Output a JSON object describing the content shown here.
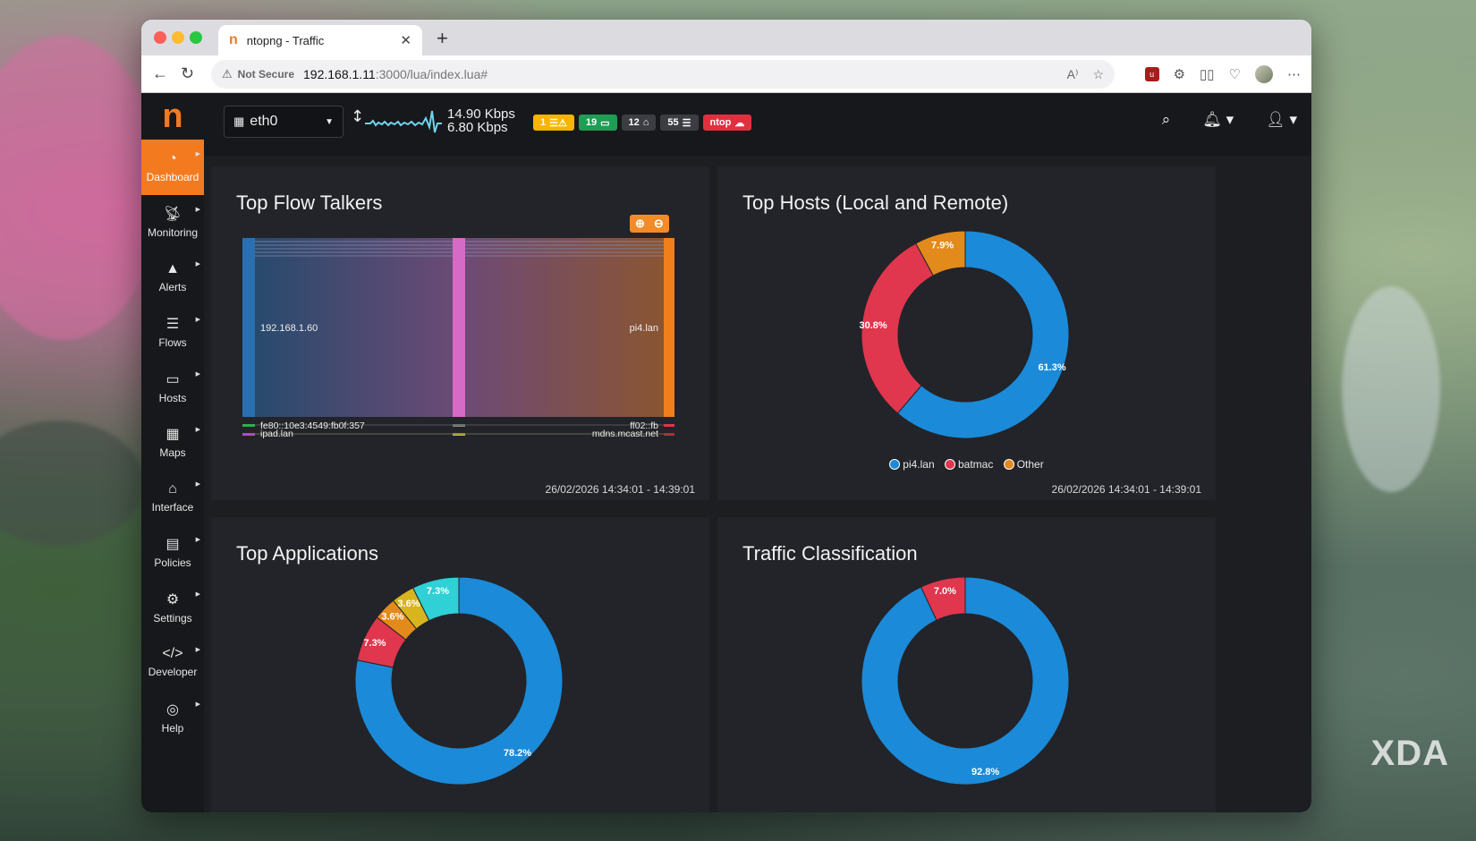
{
  "browser": {
    "tab_title": "ntopng - Traffic",
    "tab_logo": "n",
    "not_secure_label": "Not Secure",
    "url_host": "192.168.1.11",
    "url_path": ":3000/lua/index.lua#"
  },
  "app": {
    "brand": "n",
    "sidebar": [
      {
        "label": "Dashboard",
        "icon": "gauge-icon",
        "active": true
      },
      {
        "label": "Monitoring",
        "icon": "satellite-dish-icon",
        "active": false
      },
      {
        "label": "Alerts",
        "icon": "warning-icon",
        "active": false
      },
      {
        "label": "Flows",
        "icon": "list-icon",
        "active": false
      },
      {
        "label": "Hosts",
        "icon": "laptop-icon",
        "active": false
      },
      {
        "label": "Maps",
        "icon": "map-icon",
        "active": false
      },
      {
        "label": "Interface",
        "icon": "ethernet-icon",
        "active": false
      },
      {
        "label": "Policies",
        "icon": "book-icon",
        "active": false
      },
      {
        "label": "Settings",
        "icon": "gear-icon",
        "active": false
      },
      {
        "label": "Developer",
        "icon": "code-icon",
        "active": false
      },
      {
        "label": "Help",
        "icon": "life-ring-icon",
        "active": false
      }
    ],
    "topbar": {
      "interface": "eth0",
      "rate_up": "14.90 Kbps",
      "rate_down": "6.80 Kbps",
      "badges": [
        {
          "count": "1",
          "icon": "alert-list-icon",
          "color": "#f7b500"
        },
        {
          "count": "19",
          "icon": "host-icon",
          "color": "#1f9d55"
        },
        {
          "count": "12",
          "icon": "device-icon",
          "color": "#3b3d42"
        },
        {
          "count": "55",
          "icon": "flows-icon",
          "color": "#3b3d42"
        },
        {
          "count": "ntop",
          "icon": "cloud-icon",
          "color": "#e0303f"
        }
      ]
    }
  },
  "cards": {
    "flow_talkers": {
      "title": "Top Flow Talkers",
      "date": "26/02/2026 14:34:01 - 14:39:01",
      "left_main": "192.168.1.60",
      "right_main": "pi4.lan",
      "left_small": [
        "fe80::10e3:4549:fb0f:357",
        "ipad.lan"
      ],
      "right_small": [
        "ff02::fb",
        "mdns.mcast.net"
      ]
    },
    "top_hosts": {
      "title": "Top Hosts (Local and Remote)",
      "date": "26/02/2026 14:34:01 - 14:39:01",
      "legend": [
        "pi4.lan",
        "batmac",
        "Other"
      ]
    },
    "top_apps": {
      "title": "Top Applications"
    },
    "traffic_class": {
      "title": "Traffic Classification"
    }
  },
  "chart_data": [
    {
      "type": "pie",
      "title": "Top Hosts (Local and Remote)",
      "labels": [
        "pi4.lan",
        "batmac",
        "Other"
      ],
      "values": [
        61.3,
        30.8,
        7.9
      ],
      "colors": [
        "#1b8ad8",
        "#e0364e",
        "#e38a1c"
      ]
    },
    {
      "type": "pie",
      "title": "Top Applications",
      "labels": [
        "",
        "",
        "",
        "",
        ""
      ],
      "values": [
        78.2,
        7.3,
        3.6,
        3.6,
        7.3
      ],
      "colors": [
        "#1b8ad8",
        "#e0364e",
        "#e38a1c",
        "#d9b51d",
        "#2fd0d6"
      ]
    },
    {
      "type": "pie",
      "title": "Traffic Classification",
      "labels": [
        "",
        ""
      ],
      "values": [
        92.8,
        7.0
      ],
      "colors": [
        "#1b8ad8",
        "#e0364e"
      ]
    }
  ],
  "watermark": "XDA"
}
